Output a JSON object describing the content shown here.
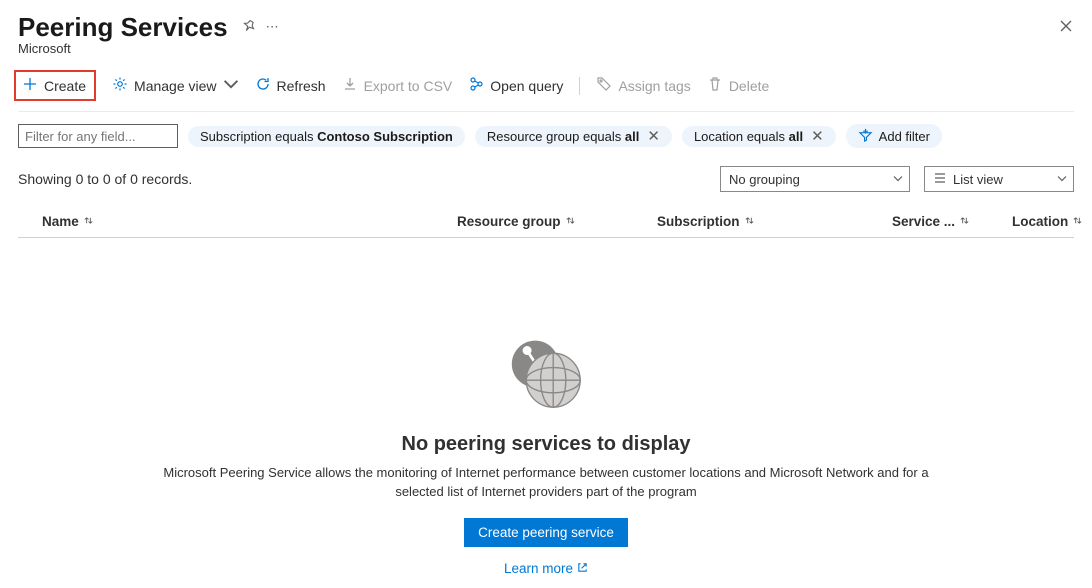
{
  "header": {
    "title": "Peering Services",
    "subtitle": "Microsoft"
  },
  "toolbar": {
    "create": "Create",
    "manage_view": "Manage view",
    "refresh": "Refresh",
    "export_csv": "Export to CSV",
    "open_query": "Open query",
    "assign_tags": "Assign tags",
    "delete": "Delete"
  },
  "filters": {
    "input_placeholder": "Filter for any field...",
    "subscription_prefix": "Subscription equals ",
    "subscription_value": "Contoso Subscription",
    "rg_prefix": "Resource group equals ",
    "rg_value": "all",
    "location_prefix": "Location equals ",
    "location_value": "all",
    "add_filter": "Add filter"
  },
  "results": {
    "records": "Showing 0 to 0 of 0 records.",
    "grouping": "No grouping",
    "view": "List view"
  },
  "columns": {
    "name": "Name",
    "rg": "Resource group",
    "sub": "Subscription",
    "svc": "Service ...",
    "loc": "Location"
  },
  "empty": {
    "title": "No peering services to display",
    "desc": "Microsoft Peering Service allows the monitoring of Internet performance between customer locations and Microsoft Network and for a selected list of Internet providers part of the program",
    "button": "Create peering service",
    "learn": "Learn more"
  }
}
